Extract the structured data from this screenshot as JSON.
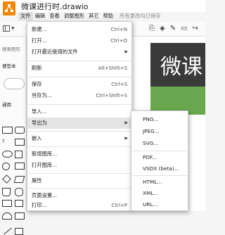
{
  "window": {
    "title": "微课进行时.drawio"
  },
  "menubar": {
    "items": [
      "文件",
      "编辑",
      "查看",
      "调整图形",
      "其它",
      "帮助"
    ],
    "saved_status": "所有更改均已保存"
  },
  "sidebar": {
    "search_placeholder": "搜索图形",
    "section1": "便签本",
    "section2": "通用"
  },
  "canvas": {
    "slide_text": "微课"
  },
  "file_menu": {
    "items": [
      {
        "label": "新建...",
        "shortcut": "Ctrl+N"
      },
      {
        "label": "打开...",
        "shortcut": "Ctrl+O"
      },
      {
        "label": "打开最近使用的文件"
      },
      {
        "label": "刷新",
        "shortcut": "Alt+Shift+S"
      },
      {
        "label": "保存",
        "shortcut": "Ctrl+S"
      },
      {
        "label": "另存为...",
        "shortcut": "Ctrl+Shift+S"
      },
      {
        "label": "导入..."
      },
      {
        "label": "导出为"
      },
      {
        "label": "嵌入"
      },
      {
        "label": "新增图库..."
      },
      {
        "label": "打开图库..."
      },
      {
        "label": "属性"
      },
      {
        "label": "页面设置..."
      },
      {
        "label": "打印...",
        "shortcut": "Ctrl+P"
      }
    ]
  },
  "export_submenu": {
    "items": [
      "PNG...",
      "JPEG...",
      "SVG...",
      "PDF...",
      "VSDX (beta)...",
      "HTML...",
      "XML...",
      "URL..."
    ]
  }
}
